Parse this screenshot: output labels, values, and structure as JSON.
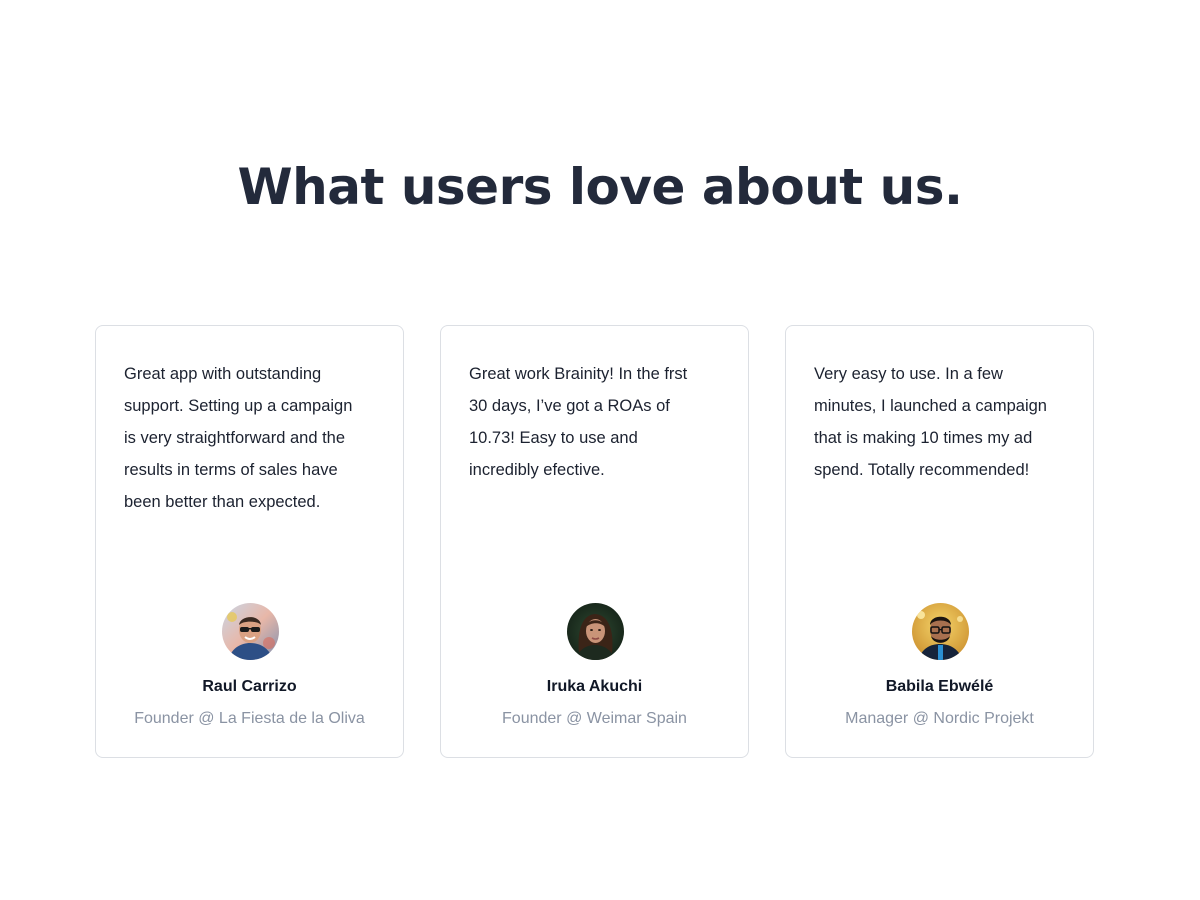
{
  "section": {
    "title": "What users love about us."
  },
  "testimonials": [
    {
      "quote": "Great app with outstanding support. Setting up a campaign is very straightforward and the results in terms of sales have been better than expected.",
      "name": "Raul Carrizo",
      "role": "Founder @ La Fiesta de la Oliva",
      "avatar_icon": "avatar-man-sunglasses"
    },
    {
      "quote": "Great work Brainity! In the frst 30 days, I’ve got a ROAs of 10.73! Easy to use and incredibly efective.",
      "name": "Iruka Akuchi",
      "role": "Founder @ Weimar Spain",
      "avatar_icon": "avatar-woman"
    },
    {
      "quote": "Very easy to use. In a few minutes, I launched a campaign that is making 10 times my ad spend. Totally recommended!",
      "name": "Babila Ebwélé",
      "role": "Manager @ Nordic Projekt",
      "avatar_icon": "avatar-man-glasses"
    }
  ],
  "colors": {
    "title": "#232a3b",
    "body_text": "#1c2230",
    "muted_text": "#8a93a3",
    "card_border": "#dcdfe4"
  }
}
